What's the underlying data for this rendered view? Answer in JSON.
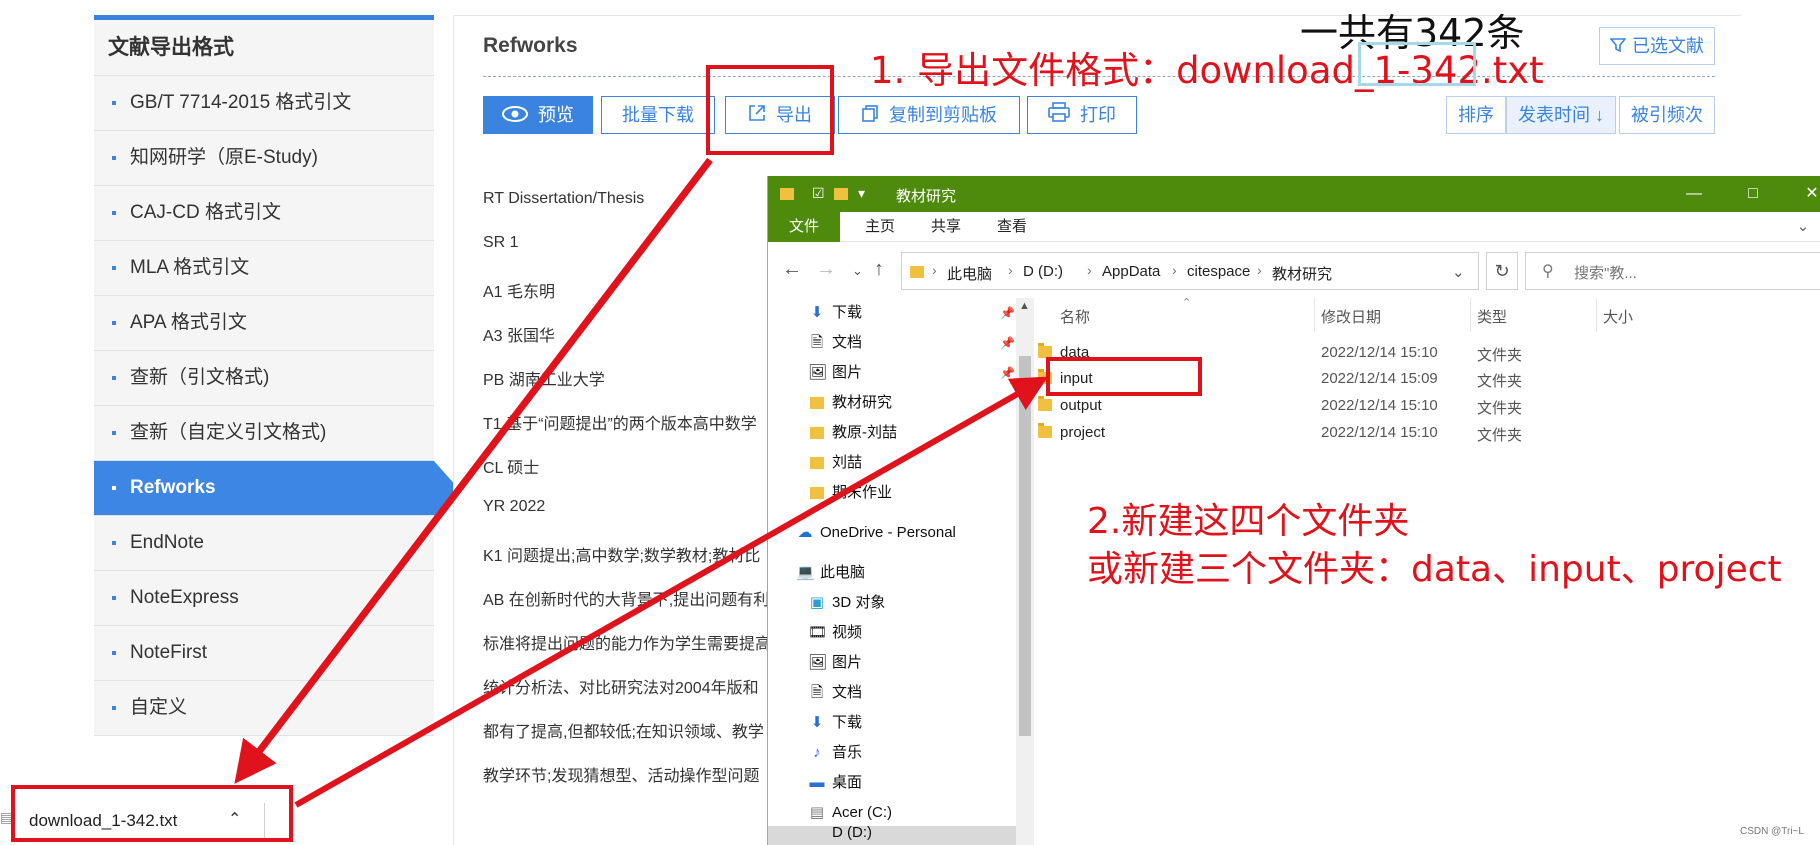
{
  "format_menu": {
    "title": "文献导出格式",
    "items": [
      {
        "label": "GB/T 7714-2015 格式引文"
      },
      {
        "label": "知网研学（原E-Study)"
      },
      {
        "label": "CAJ-CD 格式引文"
      },
      {
        "label": "MLA 格式引文"
      },
      {
        "label": "APA 格式引文"
      },
      {
        "label": "查新（引文格式)"
      },
      {
        "label": "查新（自定义引文格式)"
      },
      {
        "label": "Refworks",
        "active": true
      },
      {
        "label": "EndNote"
      },
      {
        "label": "NoteExpress"
      },
      {
        "label": "NoteFirst"
      },
      {
        "label": "自定义"
      }
    ]
  },
  "content": {
    "title": "Refworks",
    "toolbar": {
      "preview": "预览",
      "batch_download": "批量下载",
      "export": "导出",
      "copy_clipboard": "复制到剪贴板",
      "print": "打印"
    },
    "sort_buttons": {
      "sort": "排序",
      "publish_time": "发表时间",
      "cited_frequency": "被引频次"
    },
    "selected_docs": "已选文献",
    "ref_lines": [
      "RT Dissertation/Thesis",
      "SR 1",
      "A1 毛东明",
      "A3 张国华",
      "PB 湖南工业大学",
      "T1 基于“问题提出”的两个版本高中数学",
      "CL 硕士",
      "YR 2022",
      "K1 问题提出;高中数学;数学教材;教材比",
      "AB 在创新时代的大背景下,提出问题有利",
      "标准将提出问题的能力作为学生需要提高",
      "统计分析法、对比研究法对2004年版和",
      "都有了提高,但都较低;在知识领域、教学",
      "教学环节;发现猜想型、活动操作型问题"
    ]
  },
  "annotations": {
    "total_count": "一共有342条",
    "step1": "1. 导出文件格式：download_1-342.txt",
    "step2_line1": "2.新建这四个文件夹",
    "step2_line2": "或新建三个文件夹：data、input、project"
  },
  "explorer": {
    "window_title": "教材研究",
    "ribbon_tabs": [
      "文件",
      "主页",
      "共享",
      "查看"
    ],
    "breadcrumb": [
      "此电脑",
      "D (D:)",
      "AppData",
      "citespace",
      "教材研究"
    ],
    "search_placeholder": "搜索\"教...",
    "nav_items": [
      {
        "label": "下载",
        "icon": "download-icon",
        "pinned": true
      },
      {
        "label": "文档",
        "icon": "document-icon",
        "pinned": true
      },
      {
        "label": "图片",
        "icon": "picture-icon",
        "pinned": true
      },
      {
        "label": "教材研究",
        "icon": "folder-icon"
      },
      {
        "label": "教原-刘喆",
        "icon": "folder-icon"
      },
      {
        "label": "刘喆",
        "icon": "folder-icon"
      },
      {
        "label": "期末作业",
        "icon": "folder-icon"
      },
      {
        "label": "OneDrive - Personal",
        "icon": "cloud-icon"
      },
      {
        "label": "此电脑",
        "icon": "computer-icon"
      },
      {
        "label": "3D 对象",
        "icon": "cube-icon"
      },
      {
        "label": "视频",
        "icon": "video-icon"
      },
      {
        "label": "图片",
        "icon": "picture-icon"
      },
      {
        "label": "文档",
        "icon": "document-icon"
      },
      {
        "label": "下载",
        "icon": "download-icon"
      },
      {
        "label": "音乐",
        "icon": "music-icon"
      },
      {
        "label": "桌面",
        "icon": "desktop-icon"
      },
      {
        "label": "Acer (C:)",
        "icon": "drive-icon"
      },
      {
        "label": "D (D:)",
        "icon": "drive-icon"
      }
    ],
    "columns": {
      "name": "名称",
      "modified": "修改日期",
      "type": "类型",
      "size": "大小"
    },
    "files": [
      {
        "name": "data",
        "modified": "2022/12/14 15:10",
        "type": "文件夹"
      },
      {
        "name": "input",
        "modified": "2022/12/14 15:09",
        "type": "文件夹"
      },
      {
        "name": "output",
        "modified": "2022/12/14 15:10",
        "type": "文件夹"
      },
      {
        "name": "project",
        "modified": "2022/12/14 15:10",
        "type": "文件夹"
      }
    ]
  },
  "download_bar": {
    "filename": "download_1-342.txt"
  },
  "watermark": "CSDN @Tri~L",
  "colors": {
    "accent": "#3a84e0",
    "annotation": "#e0121b",
    "explorer_green": "#4e8a0c"
  }
}
